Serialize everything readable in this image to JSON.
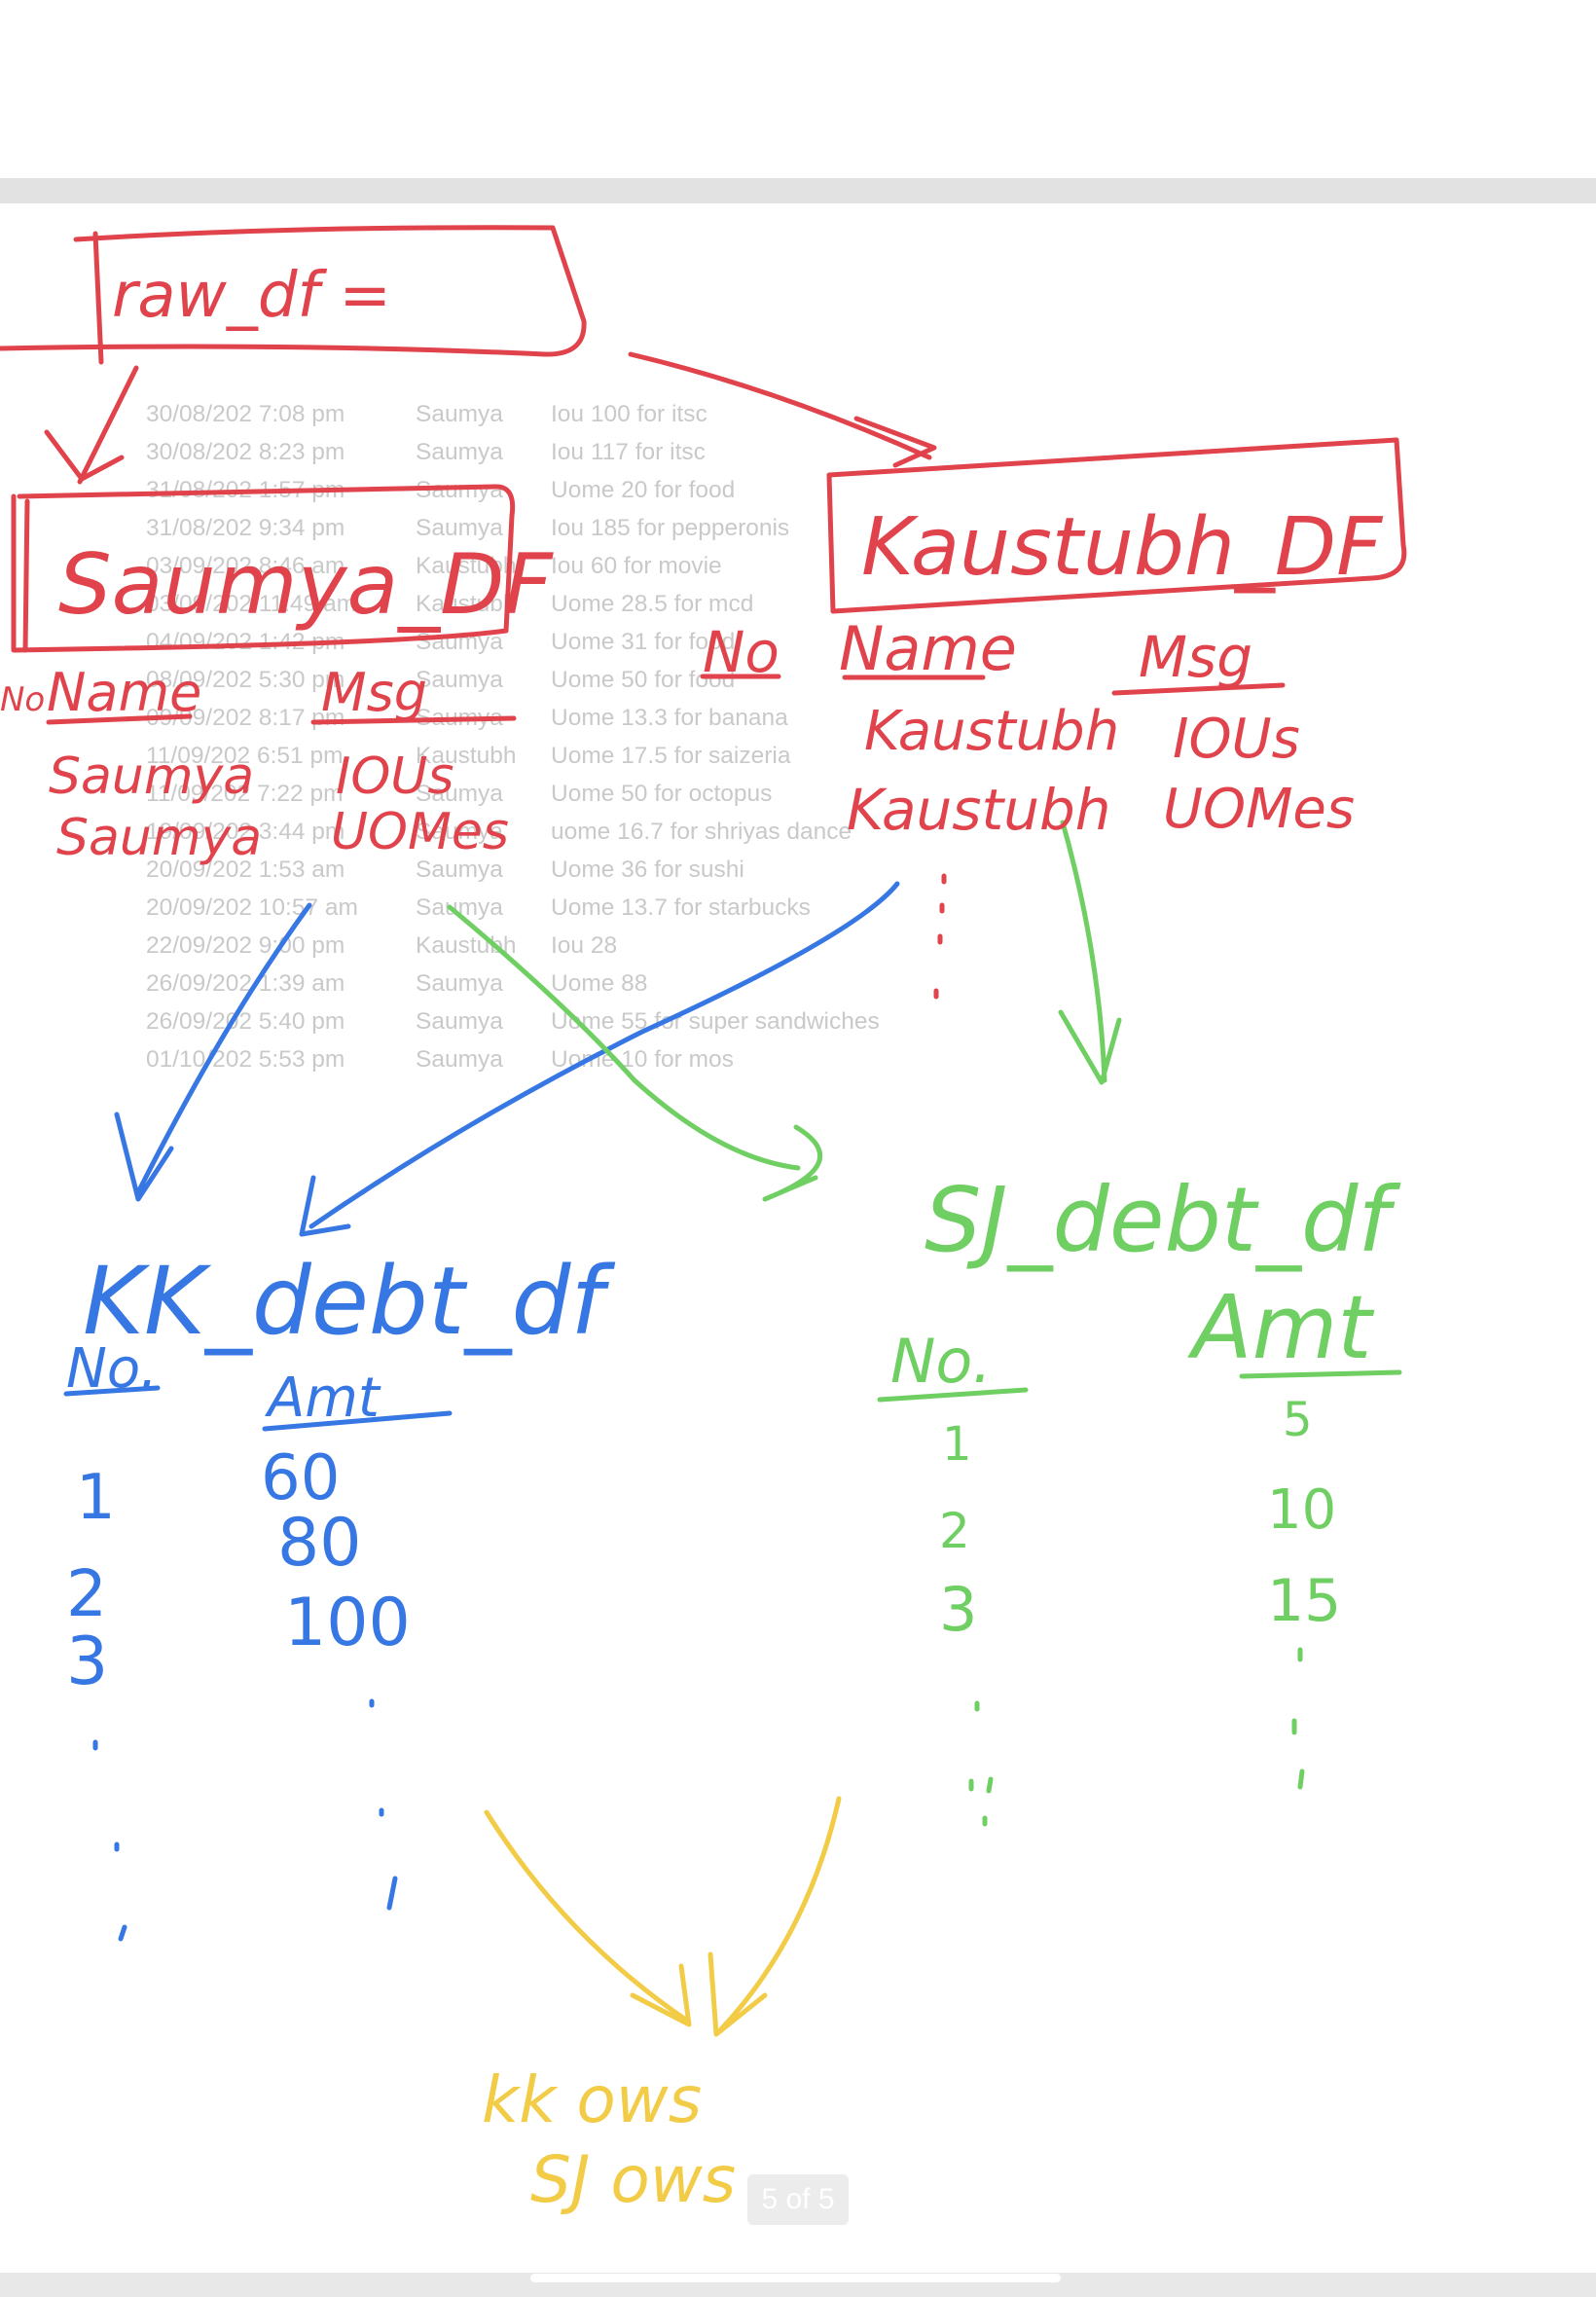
{
  "background_table": {
    "rows": [
      {
        "date": "30/08/202 7:08 pm",
        "name": "Saumya",
        "msg": "Iou 100 for itsc"
      },
      {
        "date": "30/08/202 8:23 pm",
        "name": "Saumya",
        "msg": "Iou 117 for itsc"
      },
      {
        "date": "31/08/202 1:57 pm",
        "name": "Saumya",
        "msg": "Uome 20 for food"
      },
      {
        "date": "31/08/202 9:34 pm",
        "name": "Saumya",
        "msg": "Iou 185 for pepperonis"
      },
      {
        "date": "03/09/202 8:46 am",
        "name": "Kaustubh",
        "msg": "Iou 60 for movie"
      },
      {
        "date": "03/09/202 11:49 am",
        "name": "Kaustubh",
        "msg": "Uome 28.5 for mcd"
      },
      {
        "date": "04/09/202 1:42 pm",
        "name": "Saumya",
        "msg": "Uome 31 for food"
      },
      {
        "date": "08/09/202 5:30 pm",
        "name": "Saumya",
        "msg": "Uome 50 for food"
      },
      {
        "date": "09/09/202 8:17 pm",
        "name": "Saumya",
        "msg": "Uome 13.3 for banana"
      },
      {
        "date": "11/09/202 6:51 pm",
        "name": "Kaustubh",
        "msg": "Uome 17.5 for saizeria"
      },
      {
        "date": "11/09/202 7:22 pm",
        "name": "Saumya",
        "msg": "Uome 50 for octopus"
      },
      {
        "date": "19/09/202 3:44 pm",
        "name": "Saumya",
        "msg": "uome 16.7 for shriyas dance"
      },
      {
        "date": "20/09/202 1:53 am",
        "name": "Saumya",
        "msg": "Uome 36 for sushi"
      },
      {
        "date": "20/09/202 10:57 am",
        "name": "Saumya",
        "msg": "Uome 13.7 for starbucks"
      },
      {
        "date": "22/09/202 9:00 pm",
        "name": "Kaustubh",
        "msg": "Iou 28"
      },
      {
        "date": "26/09/202 1:39 am",
        "name": "Saumya",
        "msg": "Uome 88"
      },
      {
        "date": "26/09/202 5:40 pm",
        "name": "Saumya",
        "msg": "Uome 55 for super sandwiches"
      },
      {
        "date": "01/10/202 5:53 pm",
        "name": "Saumya",
        "msg": "Uome 10 for mos"
      }
    ]
  },
  "handwriting": {
    "raw_df": "raw_df =",
    "saumya_df": "Saumya_DF",
    "saumya_headers": {
      "no": "No",
      "name": "Name",
      "msg": "Msg"
    },
    "saumya_rows": [
      {
        "name": "Saumya",
        "msg": "IOUs"
      },
      {
        "name": "Saumya",
        "msg": "UOMes"
      }
    ],
    "kaustubh_df": "Kaustubh_DF",
    "kaustubh_headers": {
      "no": "No",
      "name": "Name",
      "msg": "Msg"
    },
    "kaustubh_rows": [
      {
        "name": "Kaustubh",
        "msg": "IOUs"
      },
      {
        "name": "Kaustubh",
        "msg": "UOMes"
      }
    ],
    "kk_debt_df": "KK_debt_df",
    "kk_headers": {
      "no": "No.",
      "amt": "Amt"
    },
    "kk_rows": [
      {
        "no": "1",
        "amt": "60"
      },
      {
        "no": "2",
        "amt": "80"
      },
      {
        "no": "3",
        "amt": "100"
      }
    ],
    "sj_debt_df": "SJ_debt_df",
    "sj_headers": {
      "no": "No.",
      "amt": "Amt"
    },
    "sj_rows": [
      {
        "no": "1",
        "amt": "5"
      },
      {
        "no": "2",
        "amt": "10"
      },
      {
        "no": "3",
        "amt": "15"
      }
    ],
    "result_line1": "kk ows",
    "result_line2": "SJ ows"
  },
  "colors": {
    "red": "#e0434b",
    "blue": "#3677e3",
    "green": "#6fcf62",
    "yellow": "#f2cc47",
    "faint_text": "#c9c9c9"
  },
  "page_indicator": "5 of 5"
}
